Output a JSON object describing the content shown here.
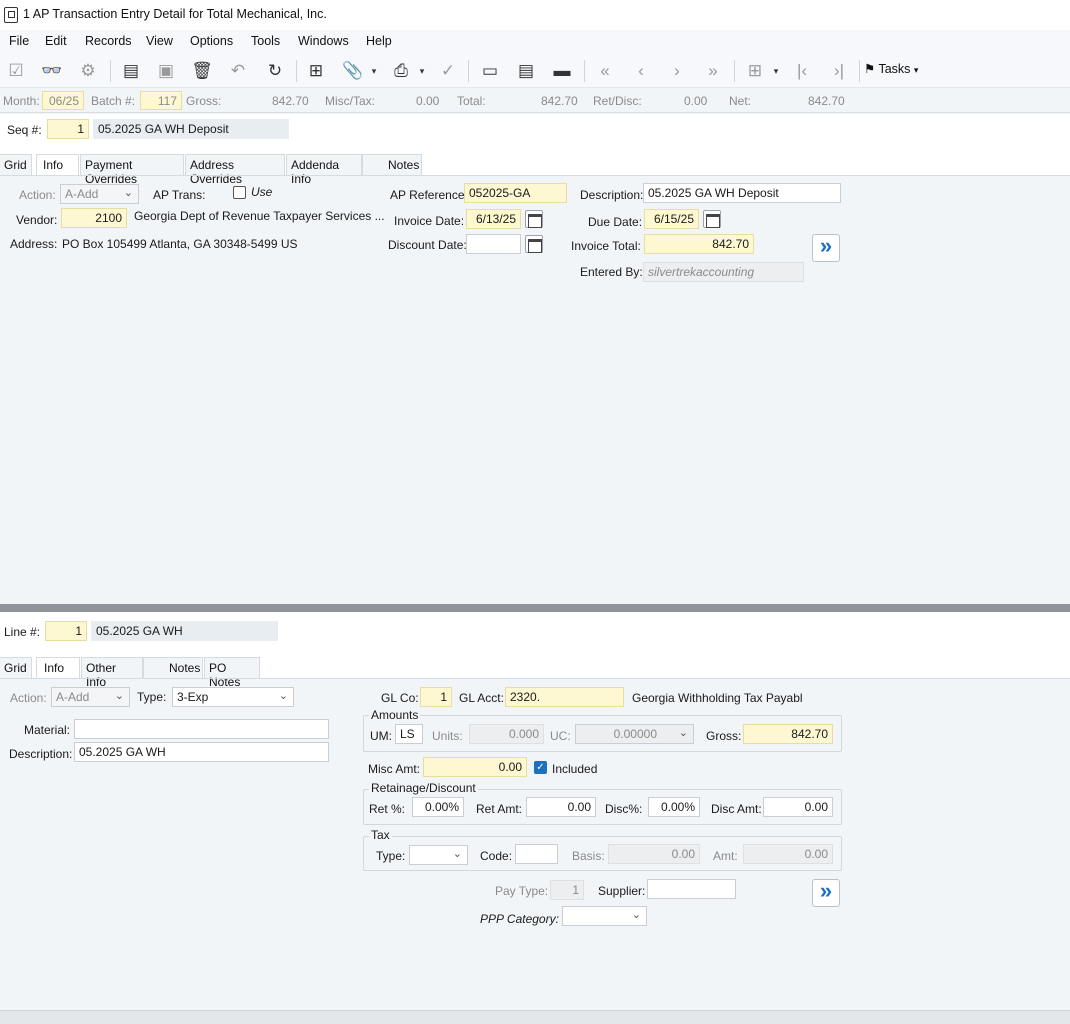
{
  "window": {
    "title": "1 AP Transaction Entry Detail for Total Mechanical, Inc."
  },
  "menu": [
    "File",
    "Edit",
    "Records",
    "View",
    "Options",
    "Tools",
    "Windows",
    "Help"
  ],
  "toolbar": {
    "tasks_label": "Tasks"
  },
  "batch": {
    "month_label": "Month:",
    "month": "06/25",
    "batch_label": "Batch #:",
    "batch": "117",
    "gross_label": "Gross:",
    "gross": "842.70",
    "misctax_label": "Misc/Tax:",
    "misctax": "0.00",
    "total_label": "Total:",
    "total": "842.70",
    "retdisc_label": "Ret/Disc:",
    "retdisc": "0.00",
    "net_label": "Net:",
    "net": "842.70"
  },
  "header": {
    "seq_label": "Seq #:",
    "seq": "1",
    "seq_desc": "05.2025 GA WH Deposit",
    "tabs": [
      "Grid",
      "Info",
      "Payment Overrides",
      "Address Overrides",
      "Addenda Info",
      "Notes"
    ],
    "action_label": "Action:",
    "action": "A-Add",
    "aptrans_label": "AP Trans:",
    "use_label": "Use",
    "vendor_label": "Vendor:",
    "vendor": "2100",
    "vendor_name": "Georgia Dept of Revenue Taxpayer Services ...",
    "address_label": "Address:",
    "address": "PO Box 105499  Atlanta, GA  30348-5499  US",
    "apref_label": "AP Reference:",
    "apref": "052025-GA",
    "invdate_label": "Invoice Date:",
    "invdate": "6/13/25",
    "discdate_label": "Discount Date:",
    "discdate": "",
    "description_label": "Description:",
    "description": "05.2025 GA WH Deposit",
    "duedate_label": "Due Date:",
    "duedate": "6/15/25",
    "invtotal_label": "Invoice Total:",
    "invtotal": "842.70",
    "enteredby_label": "Entered By:",
    "enteredby": "silvertrekaccounting"
  },
  "line": {
    "line_label": "Line #:",
    "line": "1",
    "line_desc": "05.2025 GA WH",
    "tabs": [
      "Grid",
      "Info",
      "Other Info",
      "Notes",
      "PO Notes"
    ],
    "action_label": "Action:",
    "action": "A-Add",
    "type_label": "Type:",
    "type": "3-Exp",
    "material_label": "Material:",
    "material": "",
    "description_label": "Description:",
    "description": "05.2025 GA WH",
    "glco_label": "GL Co:",
    "glco": "1",
    "glacct_label": "GL Acct:",
    "glacct": "2320.",
    "glacct_desc": "Georgia Withholding Tax Payabl",
    "amounts_label": "Amounts",
    "um_label": "UM:",
    "um": "LS",
    "units_label": "Units:",
    "units": "0.000",
    "uc_label": "UC:",
    "uc": "0.00000",
    "gross_label": "Gross:",
    "gross": "842.70",
    "miscamt_label": "Misc Amt:",
    "miscamt": "0.00",
    "included_label": "Included",
    "retdisc_label": "Retainage/Discount",
    "retpct_label": "Ret %:",
    "retpct": "0.00%",
    "retamt_label": "Ret Amt:",
    "retamt": "0.00",
    "discpct_label": "Disc%:",
    "discpct": "0.00%",
    "discamt_label": "Disc Amt:",
    "discamt": "0.00",
    "tax_label": "Tax",
    "taxtype_label": "Type:",
    "taxtype": "",
    "code_label": "Code:",
    "code": "",
    "basis_label": "Basis:",
    "basis": "0.00",
    "amt_label": "Amt:",
    "amt": "0.00",
    "paytype_label": "Pay Type:",
    "paytype": "1",
    "supplier_label": "Supplier:",
    "supplier": "",
    "ppp_label": "PPP Category:",
    "ppp": ""
  }
}
